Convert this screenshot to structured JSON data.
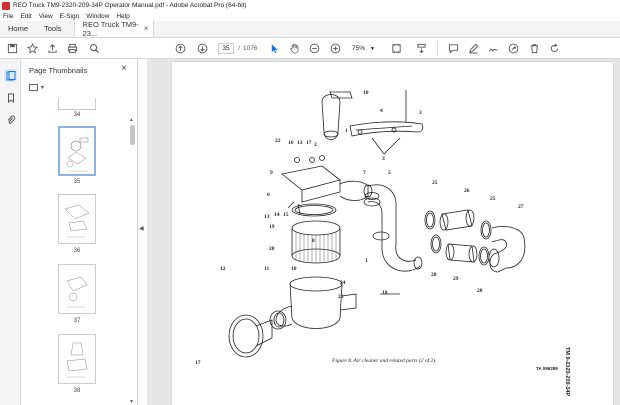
{
  "window": {
    "title": "REO Truck TM9-2320-209-34P Operator Manual.pdf - Adobe Acrobat Pro (64-bit)"
  },
  "menu": [
    "File",
    "Edit",
    "View",
    "E-Sign",
    "Window",
    "Help"
  ],
  "tabs": {
    "home": "Home",
    "tools": "Tools",
    "document": "REO Truck TM9-23...",
    "close": "×"
  },
  "toolbar": {
    "page_current": "35",
    "page_separator": "/",
    "page_total": "1076",
    "zoom": "75%",
    "icons": [
      "save-icon",
      "bookmark-star-icon",
      "upload-icon",
      "print-icon",
      "search-icon",
      "prev-page-icon",
      "next-page-icon",
      "select-cursor-icon",
      "hand-tool-icon",
      "zoom-out-icon",
      "zoom-in-icon",
      "fit-page-icon",
      "scroll-mode-icon",
      "comment-icon",
      "highlight-icon",
      "sign-icon",
      "share-icon",
      "delete-icon",
      "rotate-icon"
    ]
  },
  "panel": {
    "title": "Page Thumbnails",
    "close": "×",
    "thumbnails": [
      {
        "label": "34",
        "selected": false
      },
      {
        "label": "35",
        "selected": true
      },
      {
        "label": "36",
        "selected": false
      },
      {
        "label": "37",
        "selected": false
      },
      {
        "label": "38",
        "selected": false
      }
    ]
  },
  "document": {
    "callouts": [
      "10",
      "4",
      "3",
      "1",
      "22",
      "16",
      "13",
      "17",
      "2",
      "3",
      "9",
      "7",
      "5",
      "6",
      "25",
      "26",
      "25",
      "27",
      "14",
      "15",
      "13",
      "19",
      "20",
      "1",
      "8",
      "28",
      "29",
      "28",
      "12",
      "11",
      "10",
      "24",
      "23",
      "18"
    ],
    "caption": "Figure 8.  Air cleaner and related parts (2 of 2).",
    "doc_id": "TA 096289",
    "page_number": "17",
    "tm_number": "TM 9-2320-209-34P"
  },
  "colors": {
    "accent": "#1473e6",
    "pdf_red": "#d32f2f",
    "chrome": "#f4f4f4",
    "canvas": "#e6e6e6"
  }
}
